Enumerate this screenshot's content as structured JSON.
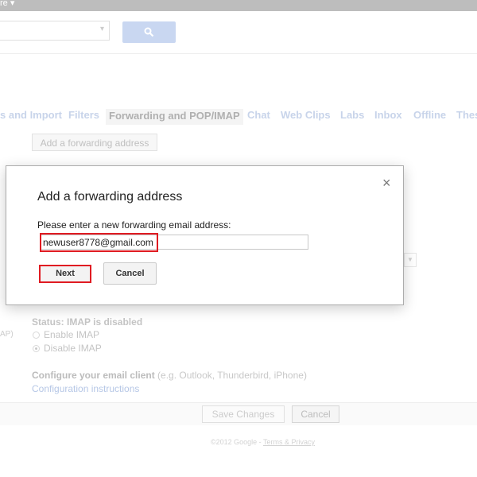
{
  "topbar": {
    "label": "re ▾"
  },
  "search": {
    "chevron": "▾",
    "icon": "search-icon"
  },
  "tabs": [
    {
      "label": "s and Import"
    },
    {
      "label": "Filters"
    },
    {
      "label": "Forwarding and POP/IMAP",
      "active": true
    },
    {
      "label": "Chat"
    },
    {
      "label": "Web Clips"
    },
    {
      "label": "Labs"
    },
    {
      "label": "Inbox"
    },
    {
      "label": "Offline"
    },
    {
      "label": "Thes"
    }
  ],
  "forwarding": {
    "add_button": "Add a forwarding address"
  },
  "imap": {
    "status": "Status: IMAP is disabled",
    "side_label": "AP)",
    "enable_label": "Enable IMAP",
    "disable_label": "Disable IMAP"
  },
  "client": {
    "heading": "Configure your email client",
    "hint": "(e.g. Outlook, Thunderbird, iPhone)",
    "link": "Configuration instructions"
  },
  "actions": {
    "save": "Save Changes",
    "cancel": "Cancel"
  },
  "footer": {
    "copyright": "©2012 Google - ",
    "terms": "Terms & Privacy"
  },
  "dialog": {
    "title": "Add a forwarding address",
    "close": "×",
    "prompt": "Please enter a new forwarding email address:",
    "email_value": "newuser8778@gmail.com",
    "next": "Next",
    "cancel": "Cancel"
  },
  "colors": {
    "highlight": "#e01b22",
    "link": "#b6c7e6",
    "search_button": "#c9d7f1"
  }
}
